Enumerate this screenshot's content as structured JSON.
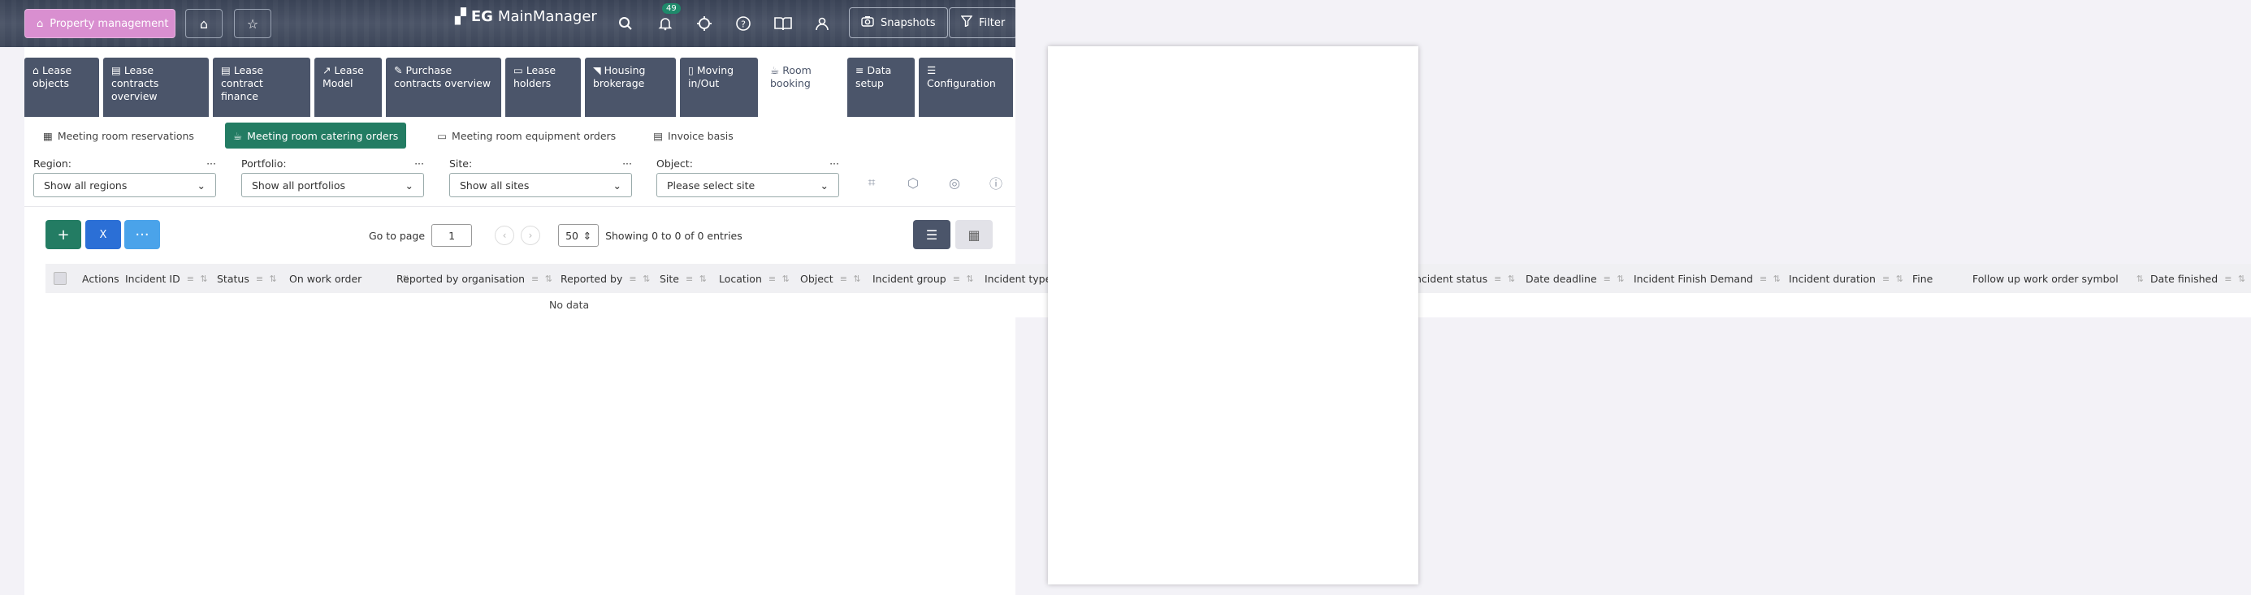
{
  "topbar": {
    "module_button": "Property management",
    "app_title_prefix": "EG",
    "app_title": "MainManager",
    "notification_count": "49",
    "snapshots_label": "Snapshots",
    "filter_label": "Filter"
  },
  "tabs": [
    {
      "label": "Lease objects",
      "icon": "house-icon"
    },
    {
      "label": "Lease contracts overview",
      "icon": "document-icon"
    },
    {
      "label": "Lease contract finance",
      "icon": "document-icon"
    },
    {
      "label": "Lease Model",
      "icon": "chart-icon"
    },
    {
      "label": "Purchase contracts overview",
      "icon": "document-edit-icon"
    },
    {
      "label": "Lease holders",
      "icon": "id-card-icon"
    },
    {
      "label": "Housing brokerage",
      "icon": "tag-icon"
    },
    {
      "label": "Moving in/Out",
      "icon": "door-icon"
    },
    {
      "label": "Room booking",
      "icon": "coffee-icon"
    },
    {
      "label": "Data setup",
      "icon": "database-icon"
    },
    {
      "label": "Configuration",
      "icon": "sliders-icon"
    }
  ],
  "subtabs": [
    {
      "label": "Meeting room reservations"
    },
    {
      "label": "Meeting room catering orders"
    },
    {
      "label": "Meeting room equipment orders"
    },
    {
      "label": "Invoice basis"
    }
  ],
  "filters": {
    "region": {
      "label": "Region:",
      "value": "Show all regions"
    },
    "portfolio": {
      "label": "Portfolio:",
      "value": "Show all portfolios"
    },
    "site": {
      "label": "Site:",
      "value": "Show all sites"
    },
    "object": {
      "label": "Object:",
      "value": "Please select site"
    }
  },
  "pager": {
    "go_to_label": "Go to page",
    "page": "1",
    "page_size": "50",
    "entries_text": "Showing 0 to 0 of 0 entries"
  },
  "columns": [
    "Actions",
    "Incident ID",
    "Status",
    "On work order",
    "Reported by organisation",
    "Reported by",
    "Site",
    "Location",
    "Object",
    "Incident group",
    "Incident type",
    "ncident status",
    "Date deadline",
    "Incident Finish Demand",
    "Incident duration",
    "Fine",
    "Follow up work order symbol",
    "Date finished"
  ],
  "empty_text": "No data",
  "colors": {
    "accent": "#237c63",
    "tab_bg": "#4b556a",
    "module_btn": "#d98fd0",
    "excel_btn": "#2b6fd6",
    "more_btn": "#4aa3ea"
  }
}
